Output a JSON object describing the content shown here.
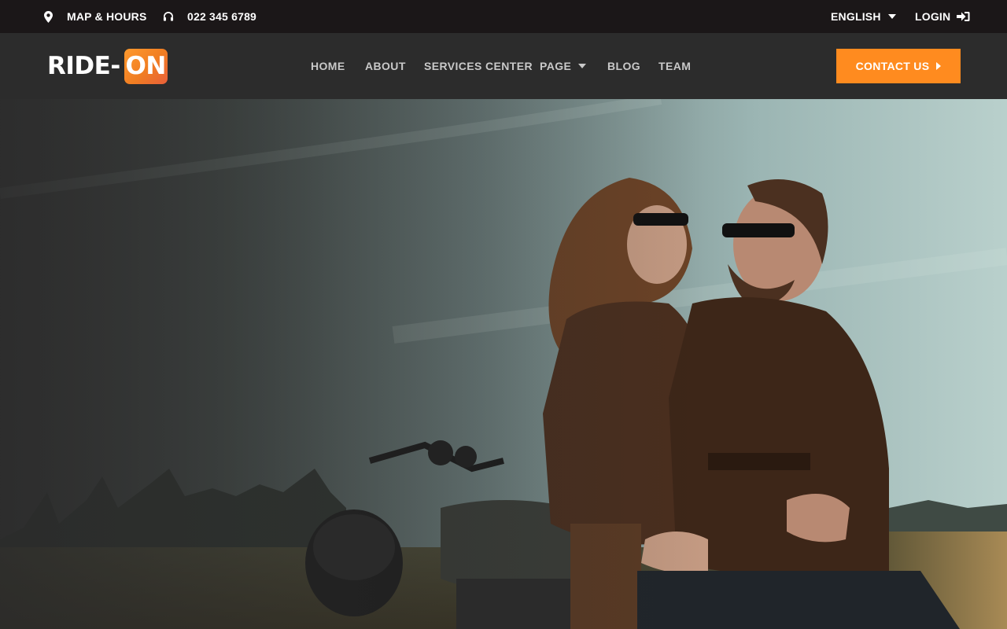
{
  "topbar": {
    "map_label": "MAP & HOURS",
    "phone": "022 345 6789",
    "language": "ENGLISH",
    "login_label": "LOGIN"
  },
  "header": {
    "logo_part1": "RIDE-",
    "logo_part2": "ON",
    "nav": {
      "home": "HOME",
      "about": "ABOUT",
      "services": "SERVICES CENTER",
      "page": "PAGE",
      "blog": "BLOG",
      "team": "TEAM"
    },
    "contact_label": "CONTACT US"
  },
  "colors": {
    "accent": "#ff8b1f",
    "topbar_bg": "#1b1718",
    "header_bg": "#2c2c2c"
  },
  "icons": {
    "map": "map-pin-icon",
    "phone": "headphones-icon",
    "login": "sign-in-icon"
  },
  "hero": {
    "image_alt": "Couple in leather jackets sitting on a motorcycle in a field"
  }
}
